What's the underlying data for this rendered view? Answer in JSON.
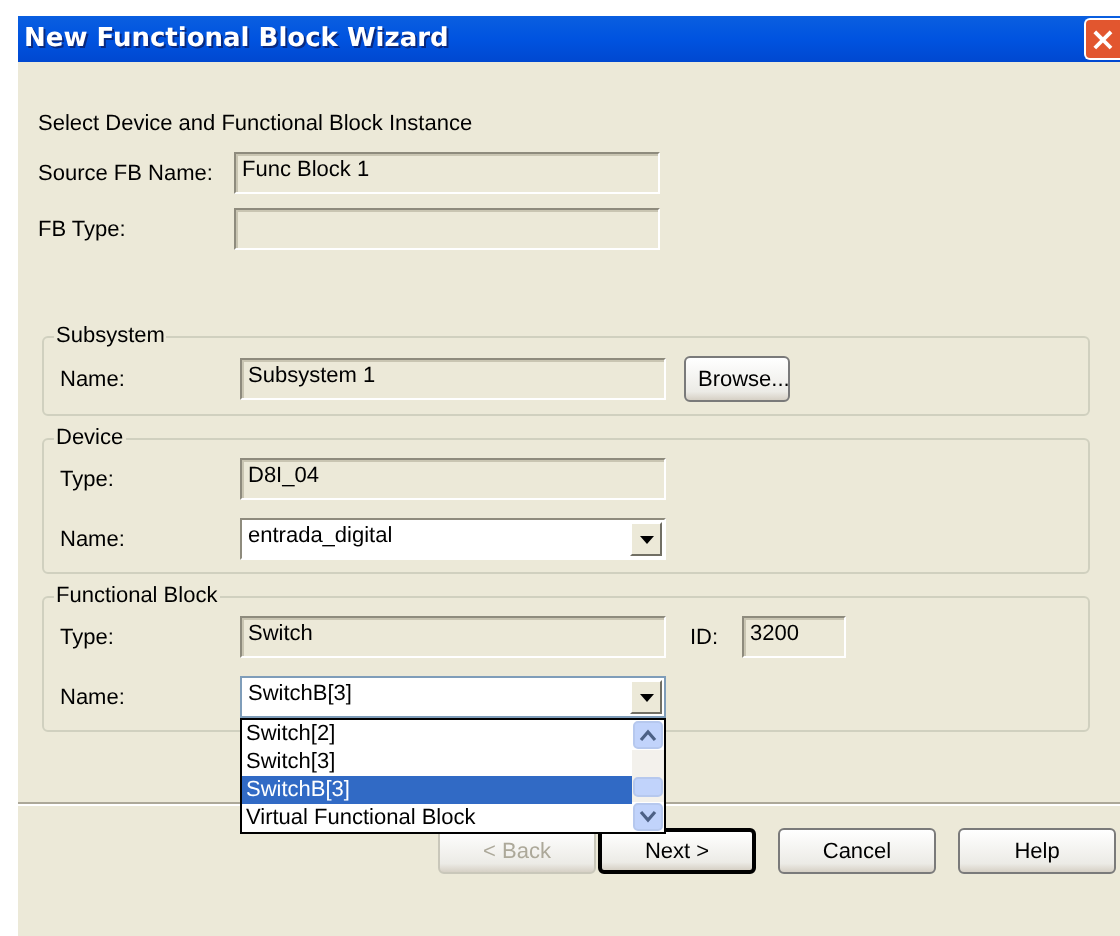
{
  "window": {
    "title": "New Functional Block Wizard",
    "close": "×"
  },
  "heading": "Select Device and Functional Block Instance",
  "source": [
    {
      "label": "Source FB Name:",
      "value": "Func Block 1"
    },
    {
      "label": "FB Type:"
    }
  ],
  "groups": [
    {
      "title": "Subsystem",
      "rows": [
        {
          "kind": "text",
          "label": "Name:",
          "value": "Subsystem 1",
          "button": "Browse..."
        }
      ]
    },
    {
      "title": "Device",
      "rows": [
        {
          "kind": "text",
          "label": "Type:",
          "value": "D8I_04"
        },
        {
          "kind": "combo",
          "label": "Name:",
          "value": "entrada_digital"
        }
      ]
    },
    {
      "title": "Functional Block",
      "rows": [
        {
          "kind": "text",
          "label": "Type:",
          "value": "Switch",
          "id_label": "ID:",
          "id_value": "3200"
        },
        {
          "kind": "combo",
          "label": "Name:",
          "value": "SwitchB[3]",
          "expanded": true,
          "options": [
            {
              "label": "Switch[2]",
              "selected": false
            },
            {
              "label": "Switch[3]",
              "selected": false
            },
            {
              "label": "SwitchB[3]",
              "selected": true
            },
            {
              "label": "Virtual Functional Block",
              "selected": false
            }
          ]
        }
      ]
    }
  ],
  "buttons": [
    {
      "label": "< Back",
      "disabled": true,
      "default": false
    },
    {
      "label": "Next >",
      "disabled": false,
      "default": true
    },
    {
      "label": "Cancel",
      "disabled": false,
      "default": false
    },
    {
      "label": "Help",
      "disabled": false,
      "default": false
    }
  ]
}
